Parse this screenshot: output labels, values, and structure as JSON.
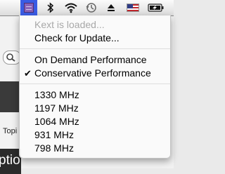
{
  "menubar": {
    "icons": [
      "cpu-chip-icon",
      "bluetooth-icon",
      "wifi-icon",
      "time-machine-icon",
      "eject-icon",
      "us-flag-icon",
      "battery-icon"
    ]
  },
  "background": {
    "tab_text": "Topi",
    "section_text": "ptio"
  },
  "menu": {
    "status": "Kext is loaded...",
    "check_update": "Check for Update...",
    "mode_on_demand": "On Demand Performance",
    "mode_conservative": "Conservative Performance",
    "checkmark": "✔",
    "freq_1": "1330 MHz",
    "freq_2": "1197 MHz",
    "freq_3": "1064 MHz",
    "freq_4": "931 MHz",
    "freq_5": "798 MHz"
  }
}
